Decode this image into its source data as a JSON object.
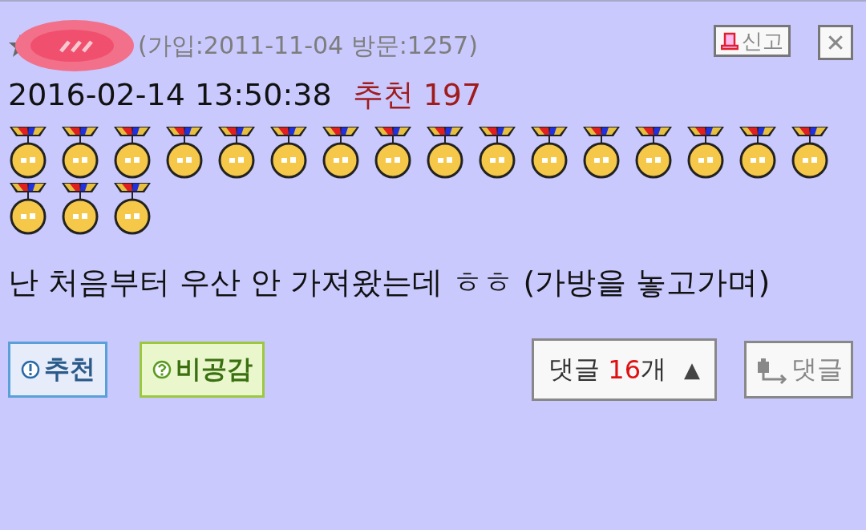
{
  "author": {
    "info": "(가입:2011-11-04 방문:1257)"
  },
  "report_button": {
    "label": "신고"
  },
  "close_button": {
    "label": "✕"
  },
  "post": {
    "datetime": "2016-02-14 13:50:38",
    "recommend_label": "추천",
    "recommend_count": "197"
  },
  "medals": [
    {
      "kind": "gold"
    },
    {
      "kind": "gold"
    },
    {
      "kind": "gold"
    },
    {
      "kind": "gold"
    },
    {
      "kind": "gold"
    },
    {
      "kind": "gold"
    },
    {
      "kind": "gold"
    },
    {
      "kind": "gold"
    },
    {
      "kind": "gold"
    },
    {
      "kind": "gold"
    },
    {
      "kind": "gold"
    },
    {
      "kind": "gold"
    },
    {
      "kind": "gold"
    },
    {
      "kind": "gold"
    },
    {
      "kind": "gold"
    },
    {
      "kind": "gold"
    },
    {
      "kind": "gold"
    },
    {
      "kind": "gold"
    },
    {
      "kind": "gold"
    }
  ],
  "comment": "난 처음부터 우산 안 가져왔는데 ㅎㅎ (가방을 놓고가며)",
  "actions": [
    {
      "kind": "recommend",
      "label": "추천"
    },
    {
      "kind": "disagree",
      "label": "비공감"
    }
  ],
  "replies_toggle": {
    "prefix": "댓글",
    "count": "16",
    "suffix": "개",
    "arrow": "▲"
  },
  "reply_button": {
    "label": "댓글"
  }
}
